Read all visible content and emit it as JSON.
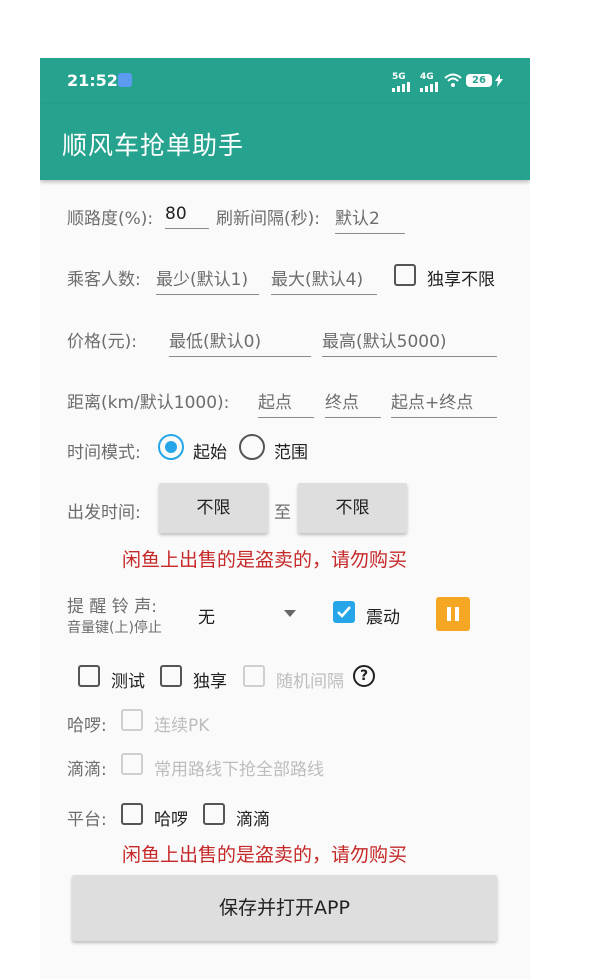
{
  "status": {
    "time": "21:52",
    "net1": "5G",
    "net2": "4G",
    "battery": "26"
  },
  "app": {
    "title": "顺风车抢单助手"
  },
  "row1": {
    "detour_label": "顺路度(%):",
    "detour_value": "80",
    "refresh_label": "刷新间隔(秒):",
    "refresh_placeholder": "默认2"
  },
  "row2": {
    "label": "乘客人数:",
    "min_placeholder": "最少(默认1)",
    "max_placeholder": "最大(默认4)",
    "exclusive_label": "独享不限"
  },
  "row3": {
    "label": "价格(元):",
    "min_placeholder": "最低(默认0)",
    "max_placeholder": "最高(默认5000)"
  },
  "row4": {
    "label": "距离(km/默认1000):",
    "start_placeholder": "起点",
    "end_placeholder": "终点",
    "both_placeholder": "起点+终点"
  },
  "time_mode": {
    "label": "时间模式:",
    "option_start": "起始",
    "option_range": "范围",
    "selected": "起始"
  },
  "depart": {
    "label": "出发时间:",
    "from": "不限",
    "to_label": "至",
    "to": "不限"
  },
  "warning": "闲鱼上出售的是盗卖的，请勿购买",
  "ringtone": {
    "label": "提 醒 铃 声:",
    "hint": "音量键(上)停止",
    "selected": "无",
    "vibrate_label": "震动",
    "vibrate_checked": true
  },
  "options": {
    "test_label": "测试",
    "exclusive_label": "独享",
    "random_label": "随机间隔",
    "help": "?"
  },
  "hello": {
    "label": "哈啰:",
    "continuous_pk": "连续PK"
  },
  "didi": {
    "label": "滴滴:",
    "all_routes": "常用路线下抢全部路线"
  },
  "platform": {
    "label": "平台:",
    "hello": "哈啰",
    "didi": "滴滴"
  },
  "save_button": "保存并打开APP",
  "colors": {
    "primary": "#26a38f",
    "accent": "#26a6e8",
    "warning": "#c62828",
    "pause": "#f5a623"
  }
}
